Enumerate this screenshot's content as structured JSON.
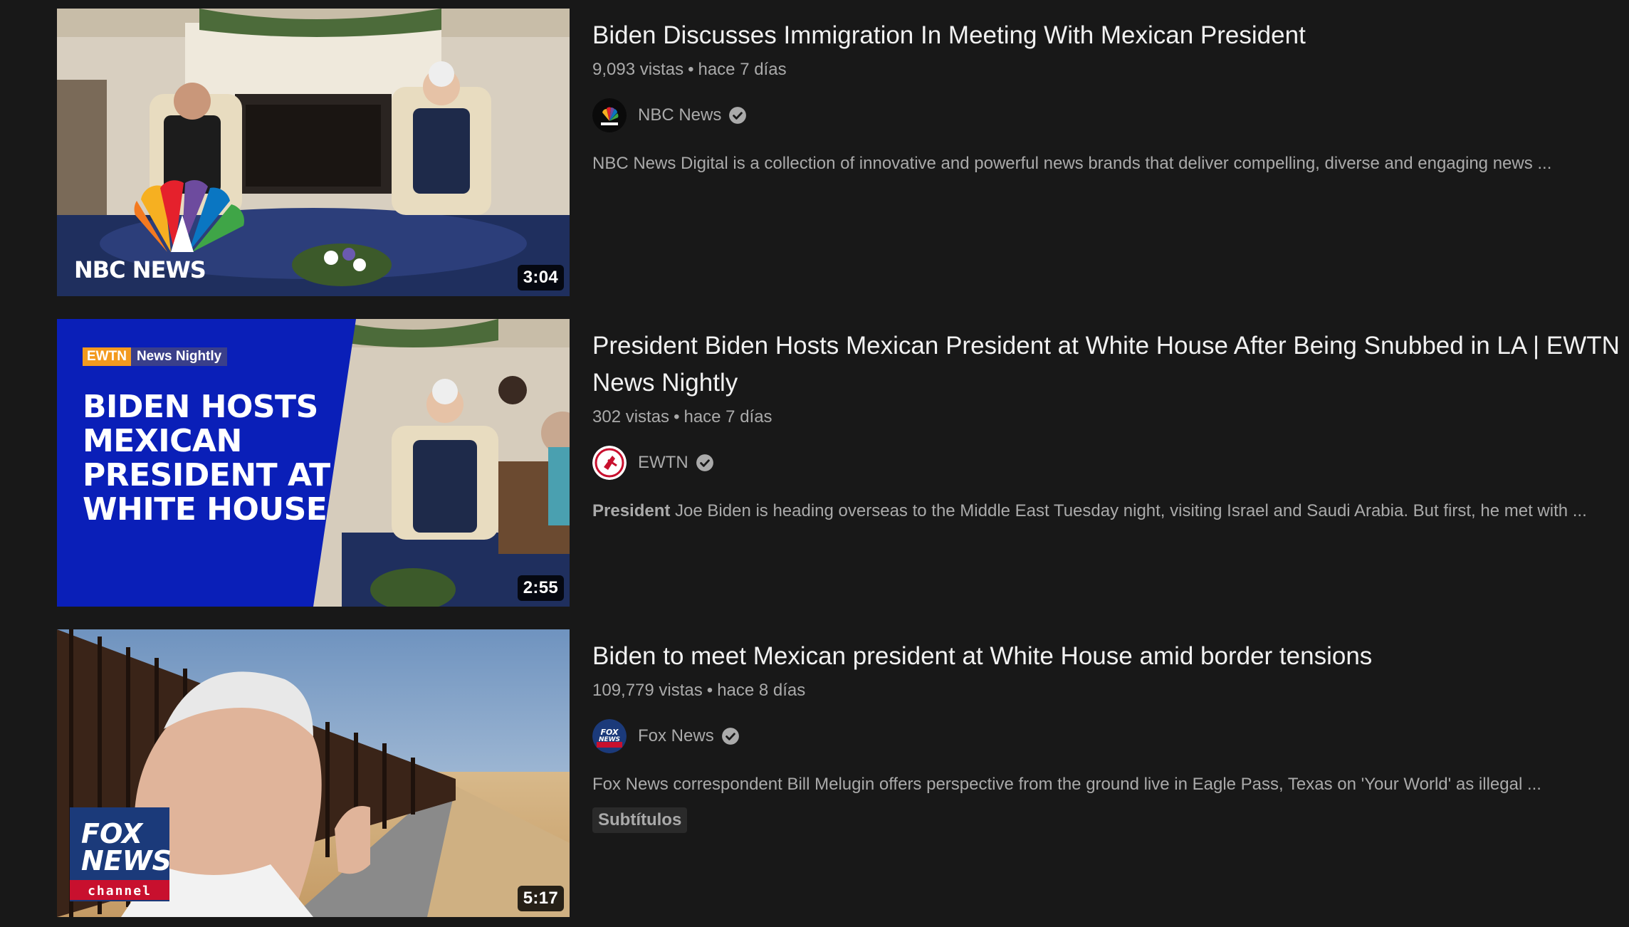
{
  "videos": [
    {
      "title": "Biden Discusses Immigration In Meeting With Mexican President",
      "views": "9,093 vistas",
      "separator": "•",
      "age": "hace 7 días",
      "channel": "NBC News",
      "verified": true,
      "description": "NBC News Digital is a collection of innovative and powerful news brands that deliver compelling, diverse and engaging news ...",
      "duration": "3:04",
      "thumbnail_overlay": "NBC NEWS"
    },
    {
      "title": "President Biden Hosts Mexican President at White House After Being Snubbed in LA | EWTN News Nightly",
      "views": "302 vistas",
      "separator": "•",
      "age": "hace 7 días",
      "channel": "EWTN",
      "verified": true,
      "description_bold": "President",
      "description": " Joe Biden is heading overseas to the Middle East Tuesday night, visiting Israel and Saudi Arabia. But first, he met with ...",
      "duration": "2:55",
      "thumbnail_tag_left": "EWTN",
      "thumbnail_tag_right": "News Nightly",
      "thumbnail_headline": [
        "BIDEN HOSTS",
        "MEXICAN",
        "PRESIDENT AT",
        "WHITE HOUSE"
      ]
    },
    {
      "title": "Biden to meet Mexican president at White House amid border tensions",
      "views": "109,779 vistas",
      "separator": "•",
      "age": "hace 8 días",
      "channel": "Fox News",
      "verified": true,
      "description": "Fox News correspondent Bill Melugin offers perspective from the ground live in Eagle Pass, Texas on 'Your World' as illegal ...",
      "badge": "Subtítulos",
      "duration": "5:17",
      "thumbnail_logo_line1": "FOX",
      "thumbnail_logo_line2": "NEWS",
      "thumbnail_logo_line3": "channel"
    }
  ],
  "colors": {
    "background": "#181818",
    "title": "#f1f1f1",
    "secondary": "#aaaaaa",
    "ewtn_blue": "#0a1fb8",
    "ewtn_orange": "#f39a1e",
    "fox_red": "#c8102e",
    "fox_blue": "#1b3a7a"
  }
}
